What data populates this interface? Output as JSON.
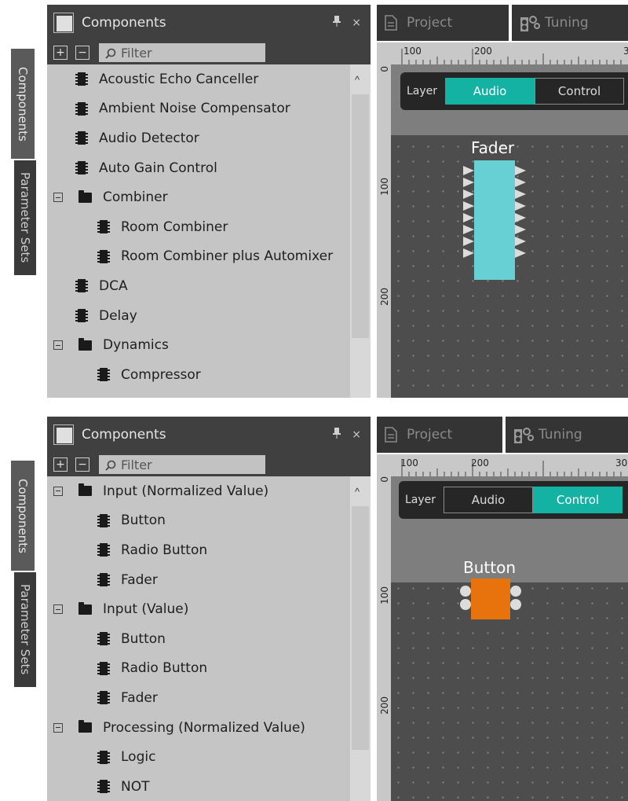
{
  "panel": {
    "title": "Components",
    "filter_placeholder": "Filter",
    "expand_all": "+",
    "collapse_all": "−",
    "pin_glyph": "📌",
    "close_glyph": "×"
  },
  "side_tabs": {
    "components": "Components",
    "parameter_sets": "Parameter Sets"
  },
  "doc_tabs": {
    "project": "Project",
    "tuning": "Tuning"
  },
  "layer": {
    "label": "Layer",
    "audio": "Audio",
    "control": "Control"
  },
  "screens": [
    {
      "active_layer": "Audio",
      "tree": [
        {
          "type": "item",
          "level": 0,
          "label": "Acoustic Echo Canceller"
        },
        {
          "type": "item",
          "level": 0,
          "label": "Ambient Noise Compensator"
        },
        {
          "type": "item",
          "level": 0,
          "label": "Audio Detector"
        },
        {
          "type": "item",
          "level": 0,
          "label": "Auto Gain Control"
        },
        {
          "type": "folder",
          "level": 0,
          "label": "Combiner"
        },
        {
          "type": "item",
          "level": 1,
          "label": "Room Combiner"
        },
        {
          "type": "item",
          "level": 1,
          "label": "Room Combiner plus Automixer"
        },
        {
          "type": "item",
          "level": 0,
          "label": "DCA"
        },
        {
          "type": "item",
          "level": 0,
          "label": "Delay"
        },
        {
          "type": "folder",
          "level": 0,
          "label": "Dynamics"
        },
        {
          "type": "item",
          "level": 1,
          "label": "Compressor"
        }
      ],
      "ruler": {
        "top": [
          "100",
          "200",
          "3"
        ],
        "left": [
          "0",
          "100",
          "200"
        ]
      },
      "block": {
        "label": "Fader",
        "color": "#66d0d4",
        "inputs": 8,
        "outputs": 8
      }
    },
    {
      "active_layer": "Control",
      "tree": [
        {
          "type": "folder",
          "level": 0,
          "label": "Input (Normalized Value)"
        },
        {
          "type": "item",
          "level": 1,
          "label": "Button"
        },
        {
          "type": "item",
          "level": 1,
          "label": "Radio Button"
        },
        {
          "type": "item",
          "level": 1,
          "label": "Fader"
        },
        {
          "type": "folder",
          "level": 0,
          "label": "Input (Value)"
        },
        {
          "type": "item",
          "level": 1,
          "label": "Button"
        },
        {
          "type": "item",
          "level": 1,
          "label": "Radio Button"
        },
        {
          "type": "item",
          "level": 1,
          "label": "Fader"
        },
        {
          "type": "folder",
          "level": 0,
          "label": "Processing (Normalized Value)"
        },
        {
          "type": "item",
          "level": 1,
          "label": "Logic"
        },
        {
          "type": "item",
          "level": 1,
          "label": "NOT"
        }
      ],
      "ruler": {
        "top": [
          "100",
          "200",
          "30"
        ],
        "left": [
          "0",
          "100",
          "200"
        ]
      },
      "block": {
        "label": "Button",
        "color": "#e8720c",
        "inputs": 2,
        "outputs": 2
      }
    }
  ],
  "colors": {
    "accent": "#13b2a3",
    "panel_bg": "#c5c5c5",
    "header_bg": "#404040",
    "canvas_bg": "#4d4d4d"
  }
}
